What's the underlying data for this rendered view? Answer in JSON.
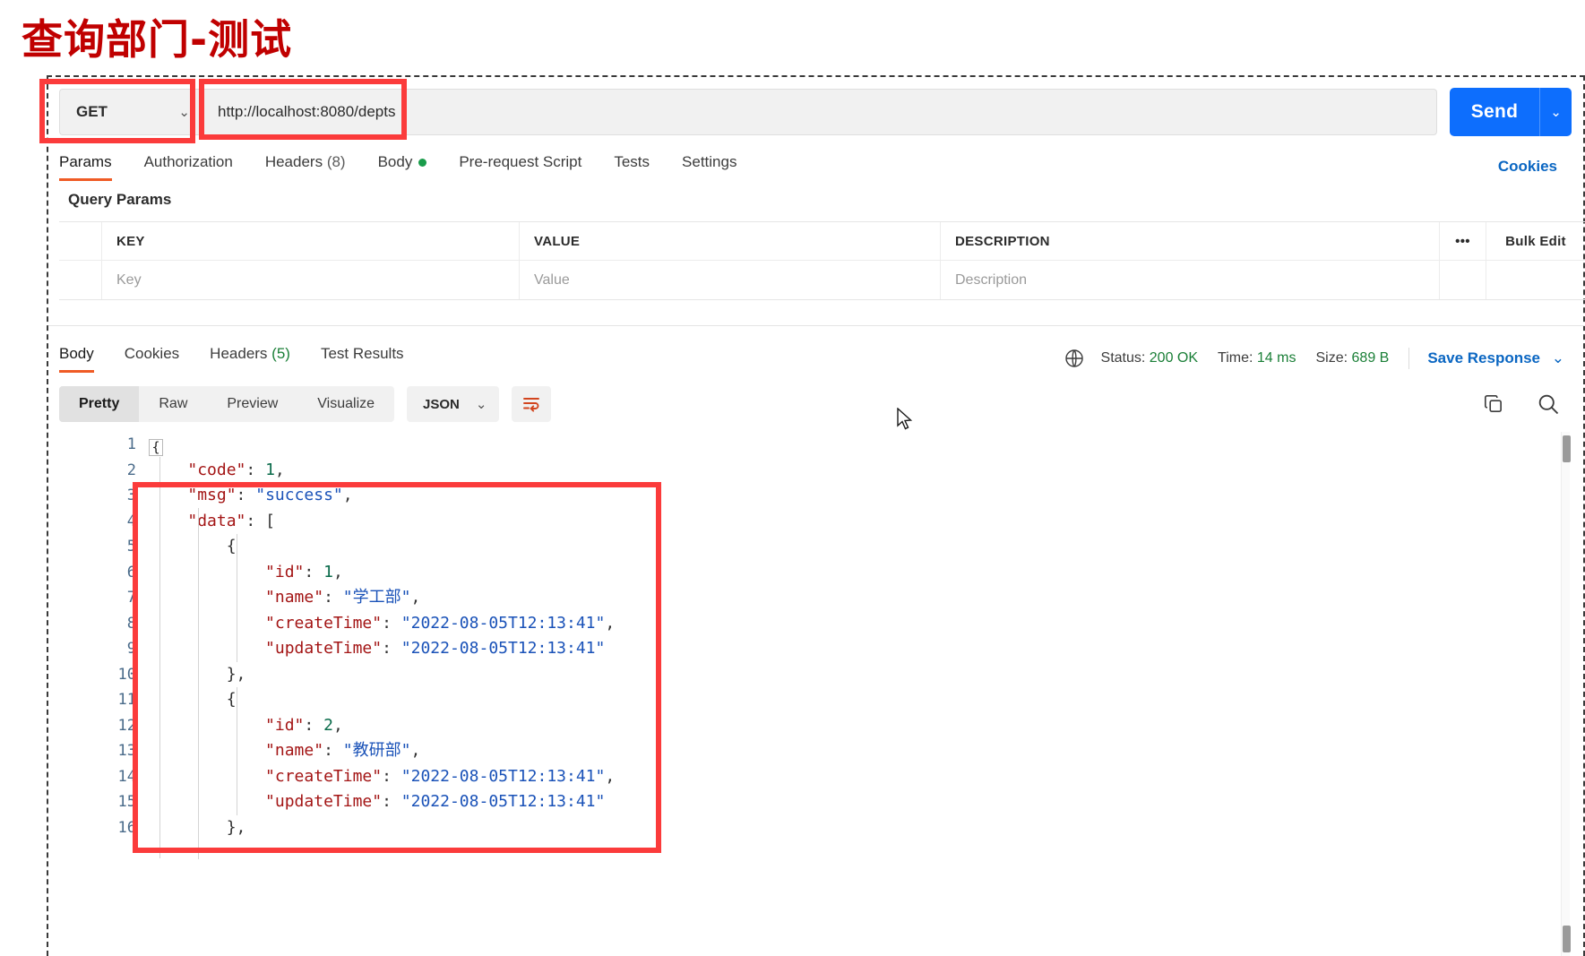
{
  "page": {
    "title": "查询部门-测试"
  },
  "request": {
    "method": "GET",
    "method_caret": "⌄",
    "url": "http://localhost:8080/depts",
    "send_label": "Send",
    "send_caret": "⌄"
  },
  "request_tabs": [
    {
      "label": "Params",
      "active": true
    },
    {
      "label": "Authorization",
      "active": false
    },
    {
      "label": "Headers",
      "count": "(8)",
      "active": false
    },
    {
      "label": "Body",
      "dot": true,
      "active": false
    },
    {
      "label": "Pre-request Script",
      "active": false
    },
    {
      "label": "Tests",
      "active": false
    },
    {
      "label": "Settings",
      "active": false
    }
  ],
  "cookies_link": "Cookies",
  "query_params": {
    "section_label": "Query Params",
    "headers": {
      "key": "KEY",
      "value": "VALUE",
      "description": "DESCRIPTION",
      "dots": "•••",
      "bulk_edit": "Bulk Edit"
    },
    "row_placeholders": {
      "key": "Key",
      "value": "Value",
      "description": "Description"
    }
  },
  "response_tabs": [
    {
      "label": "Body",
      "active": true
    },
    {
      "label": "Cookies",
      "active": false
    },
    {
      "label": "Headers",
      "count": "(5)",
      "active": false
    },
    {
      "label": "Test Results",
      "active": false
    }
  ],
  "response_status": {
    "globe_icon": "globe-icon",
    "status_label": "Status:",
    "status_value": "200 OK",
    "time_label": "Time:",
    "time_value": "14 ms",
    "size_label": "Size:",
    "size_value": "689 B",
    "save_response": "Save Response",
    "save_caret": "⌄"
  },
  "body_toolbar": {
    "views": [
      {
        "label": "Pretty",
        "active": true
      },
      {
        "label": "Raw",
        "active": false
      },
      {
        "label": "Preview",
        "active": false
      },
      {
        "label": "Visualize",
        "active": false
      }
    ],
    "format": "JSON",
    "format_caret": "⌄",
    "wrap_icon": "wrap-text-icon",
    "copy_icon": "copy-icon",
    "search_icon": "search-icon"
  },
  "json_response": {
    "line_numbers": [
      "1",
      "2",
      "3",
      "4",
      "5",
      "6",
      "7",
      "8",
      "9",
      "10",
      "11",
      "12",
      "13",
      "14",
      "15",
      "16"
    ],
    "lines": [
      {
        "n": 1,
        "fold": true,
        "tokens": [
          {
            "t": "p",
            "v": "{"
          }
        ]
      },
      {
        "n": 2,
        "tokens": [
          {
            "t": "p",
            "v": "    "
          },
          {
            "t": "k",
            "v": "\"code\""
          },
          {
            "t": "p",
            "v": ": "
          },
          {
            "t": "n",
            "v": "1"
          },
          {
            "t": "p",
            "v": ","
          }
        ]
      },
      {
        "n": 3,
        "tokens": [
          {
            "t": "p",
            "v": "    "
          },
          {
            "t": "k",
            "v": "\"msg\""
          },
          {
            "t": "p",
            "v": ": "
          },
          {
            "t": "s",
            "v": "\"success\""
          },
          {
            "t": "p",
            "v": ","
          }
        ]
      },
      {
        "n": 4,
        "tokens": [
          {
            "t": "p",
            "v": "    "
          },
          {
            "t": "k",
            "v": "\"data\""
          },
          {
            "t": "p",
            "v": ": ["
          }
        ]
      },
      {
        "n": 5,
        "tokens": [
          {
            "t": "p",
            "v": "        {"
          }
        ]
      },
      {
        "n": 6,
        "tokens": [
          {
            "t": "p",
            "v": "            "
          },
          {
            "t": "k",
            "v": "\"id\""
          },
          {
            "t": "p",
            "v": ": "
          },
          {
            "t": "n",
            "v": "1"
          },
          {
            "t": "p",
            "v": ","
          }
        ]
      },
      {
        "n": 7,
        "tokens": [
          {
            "t": "p",
            "v": "            "
          },
          {
            "t": "k",
            "v": "\"name\""
          },
          {
            "t": "p",
            "v": ": "
          },
          {
            "t": "s",
            "v": "\"学工部\""
          },
          {
            "t": "p",
            "v": ","
          }
        ]
      },
      {
        "n": 8,
        "tokens": [
          {
            "t": "p",
            "v": "            "
          },
          {
            "t": "k",
            "v": "\"createTime\""
          },
          {
            "t": "p",
            "v": ": "
          },
          {
            "t": "s",
            "v": "\"2022-08-05T12:13:41\""
          },
          {
            "t": "p",
            "v": ","
          }
        ]
      },
      {
        "n": 9,
        "tokens": [
          {
            "t": "p",
            "v": "            "
          },
          {
            "t": "k",
            "v": "\"updateTime\""
          },
          {
            "t": "p",
            "v": ": "
          },
          {
            "t": "s",
            "v": "\"2022-08-05T12:13:41\""
          }
        ]
      },
      {
        "n": 10,
        "tokens": [
          {
            "t": "p",
            "v": "        },"
          }
        ]
      },
      {
        "n": 11,
        "tokens": [
          {
            "t": "p",
            "v": "        {"
          }
        ]
      },
      {
        "n": 12,
        "tokens": [
          {
            "t": "p",
            "v": "            "
          },
          {
            "t": "k",
            "v": "\"id\""
          },
          {
            "t": "p",
            "v": ": "
          },
          {
            "t": "n",
            "v": "2"
          },
          {
            "t": "p",
            "v": ","
          }
        ]
      },
      {
        "n": 13,
        "tokens": [
          {
            "t": "p",
            "v": "            "
          },
          {
            "t": "k",
            "v": "\"name\""
          },
          {
            "t": "p",
            "v": ": "
          },
          {
            "t": "s",
            "v": "\"教研部\""
          },
          {
            "t": "p",
            "v": ","
          }
        ]
      },
      {
        "n": 14,
        "tokens": [
          {
            "t": "p",
            "v": "            "
          },
          {
            "t": "k",
            "v": "\"createTime\""
          },
          {
            "t": "p",
            "v": ": "
          },
          {
            "t": "s",
            "v": "\"2022-08-05T12:13:41\""
          },
          {
            "t": "p",
            "v": ","
          }
        ]
      },
      {
        "n": 15,
        "tokens": [
          {
            "t": "p",
            "v": "            "
          },
          {
            "t": "k",
            "v": "\"updateTime\""
          },
          {
            "t": "p",
            "v": ": "
          },
          {
            "t": "s",
            "v": "\"2022-08-05T12:13:41\""
          }
        ]
      },
      {
        "n": 16,
        "tokens": [
          {
            "t": "p",
            "v": "        },"
          }
        ]
      }
    ]
  },
  "annotations": {
    "highlight_color": "#fb3b3b",
    "boxes": [
      "method-selector",
      "url-field",
      "json-response-body"
    ]
  },
  "colors": {
    "title": "#c00000",
    "accent_tab": "#ef5b25",
    "send_blue": "#0d6efd",
    "link_blue": "#0a66c2",
    "status_green": "#1a7f37"
  }
}
